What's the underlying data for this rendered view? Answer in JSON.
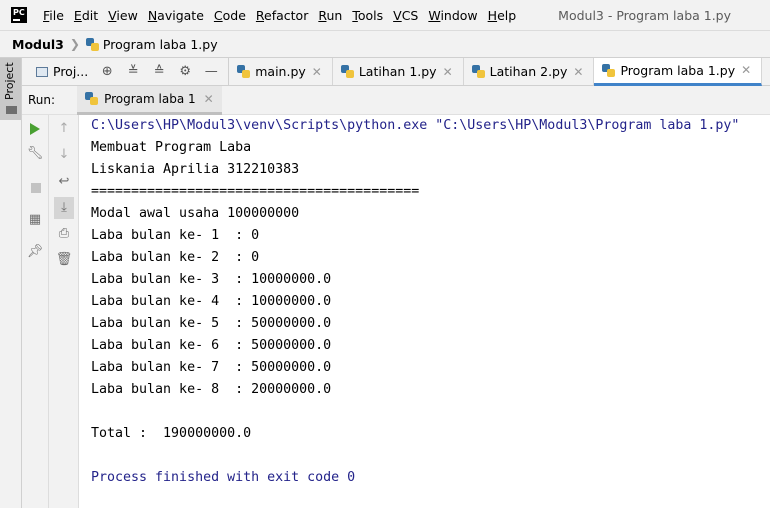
{
  "menubar": {
    "logo_text": "PC",
    "items": [
      "File",
      "Edit",
      "View",
      "Navigate",
      "Code",
      "Refactor",
      "Run",
      "Tools",
      "VCS",
      "Window",
      "Help"
    ],
    "window_title": "Modul3 - Program laba 1.py"
  },
  "navbar": {
    "project": "Modul3",
    "file": "Program laba 1.py"
  },
  "side": {
    "project_tab": "Project"
  },
  "tabsbar": {
    "project_label": "Proj...",
    "tabs": [
      {
        "label": "main.py",
        "active": false
      },
      {
        "label": "Latihan 1.py",
        "active": false
      },
      {
        "label": "Latihan 2.py",
        "active": false
      },
      {
        "label": "Program laba 1.py",
        "active": true
      }
    ]
  },
  "runbar": {
    "label": "Run:",
    "tab_label": "Program laba 1"
  },
  "console": {
    "lines": [
      {
        "text": "C:\\Users\\HP\\Modul3\\venv\\Scripts\\python.exe \"C:\\Users\\HP\\Modul3\\Program laba 1.py\"",
        "style": "blue"
      },
      {
        "text": "Membuat Program Laba",
        "style": ""
      },
      {
        "text": "Liskania Aprilia 312210383",
        "style": ""
      },
      {
        "text": "=========================================",
        "style": ""
      },
      {
        "text": "Modal awal usaha 100000000",
        "style": ""
      },
      {
        "text": "Laba bulan ke- 1  : 0",
        "style": ""
      },
      {
        "text": "Laba bulan ke- 2  : 0",
        "style": ""
      },
      {
        "text": "Laba bulan ke- 3  : 10000000.0",
        "style": ""
      },
      {
        "text": "Laba bulan ke- 4  : 10000000.0",
        "style": ""
      },
      {
        "text": "Laba bulan ke- 5  : 50000000.0",
        "style": ""
      },
      {
        "text": "Laba bulan ke- 6  : 50000000.0",
        "style": ""
      },
      {
        "text": "Laba bulan ke- 7  : 50000000.0",
        "style": ""
      },
      {
        "text": "Laba bulan ke- 8  : 20000000.0",
        "style": ""
      },
      {
        "text": "",
        "style": ""
      },
      {
        "text": "Total :  190000000.0",
        "style": ""
      },
      {
        "text": "",
        "style": ""
      },
      {
        "text": "Process finished with exit code 0",
        "style": "blue"
      }
    ]
  },
  "colors": {
    "accent_tab": "#4083c9",
    "run_green": "#49a032",
    "console_blue": "#23238a"
  }
}
